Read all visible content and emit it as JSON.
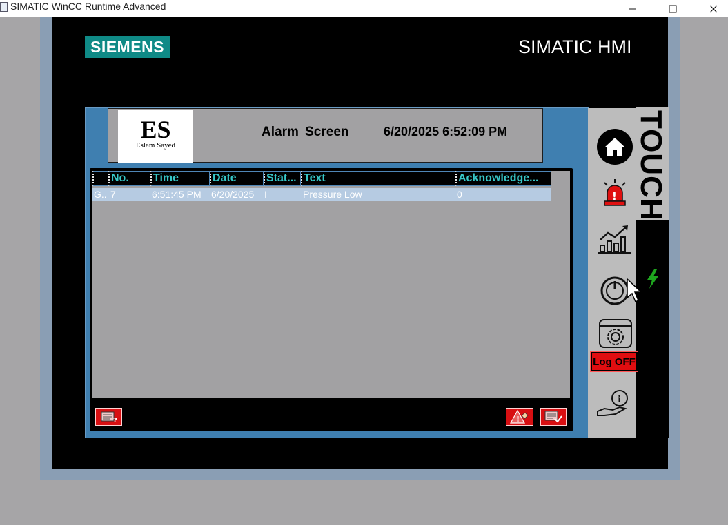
{
  "window": {
    "title": "SIMATIC WinCC Runtime Advanced",
    "controls": [
      "minimize-icon",
      "maximize-icon",
      "close-icon"
    ]
  },
  "bezel": {
    "brand": "SIEMENS",
    "product": "SIMATIC HMI"
  },
  "header": {
    "logo_initials": "ES",
    "logo_name": "Eslam Sayed",
    "title": "Alarm  Screen",
    "datetime": "6/20/2025 6:52:09 PM"
  },
  "alarm_table": {
    "columns": [
      "No.",
      "Time",
      "Date",
      "Stat...",
      "Text",
      "Acknowledge..."
    ],
    "rows": [
      {
        "prefix": "G..",
        "no": "7",
        "time": "6:51:45 PM",
        "date": "6/20/2025",
        "status": "I",
        "text": "Pressure Low",
        "ack": "0"
      }
    ]
  },
  "sidebar": {
    "items": [
      "home-icon",
      "alarm-siren-icon",
      "trend-chart-icon",
      "power-icon",
      "settings-icon"
    ],
    "logoff_label": "Log OFF",
    "info_icon": "info-hand-icon"
  },
  "side_label": "TOUCH",
  "colors": {
    "header_text": "#37c7c8",
    "alarm_red": "#d80f12",
    "siemens_teal": "#0f8a86",
    "selected_row": "#b6cbe2"
  }
}
